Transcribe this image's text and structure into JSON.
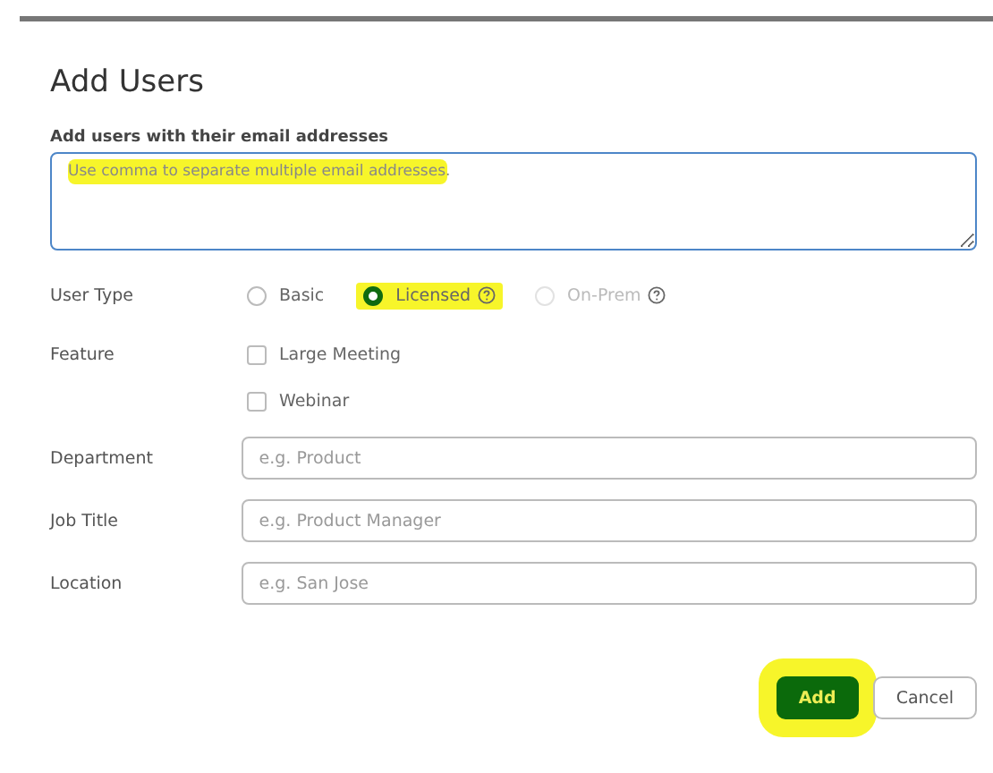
{
  "dialog": {
    "title": "Add Users"
  },
  "email": {
    "label": "Add users with their email addresses",
    "placeholder": "Use comma to separate multiple email addresses.",
    "highlighted": true
  },
  "user_type": {
    "label": "User Type",
    "options": [
      {
        "label": "Basic",
        "selected": false,
        "disabled": false,
        "help": false,
        "highlighted": false
      },
      {
        "label": "Licensed",
        "selected": true,
        "disabled": false,
        "help": true,
        "highlighted": true
      },
      {
        "label": "On-Prem",
        "selected": false,
        "disabled": true,
        "help": true,
        "highlighted": false
      }
    ]
  },
  "feature": {
    "label": "Feature",
    "options": [
      {
        "label": "Large Meeting",
        "checked": false
      },
      {
        "label": "Webinar",
        "checked": false
      }
    ]
  },
  "fields": [
    {
      "label": "Department",
      "placeholder": "e.g. Product"
    },
    {
      "label": "Job Title",
      "placeholder": "e.g. Product Manager"
    },
    {
      "label": "Location",
      "placeholder": "e.g. San Jose"
    }
  ],
  "buttons": [
    {
      "label": "Add",
      "kind": "primary",
      "highlighted": true
    },
    {
      "label": "Cancel",
      "kind": "secondary",
      "highlighted": false
    }
  ]
}
